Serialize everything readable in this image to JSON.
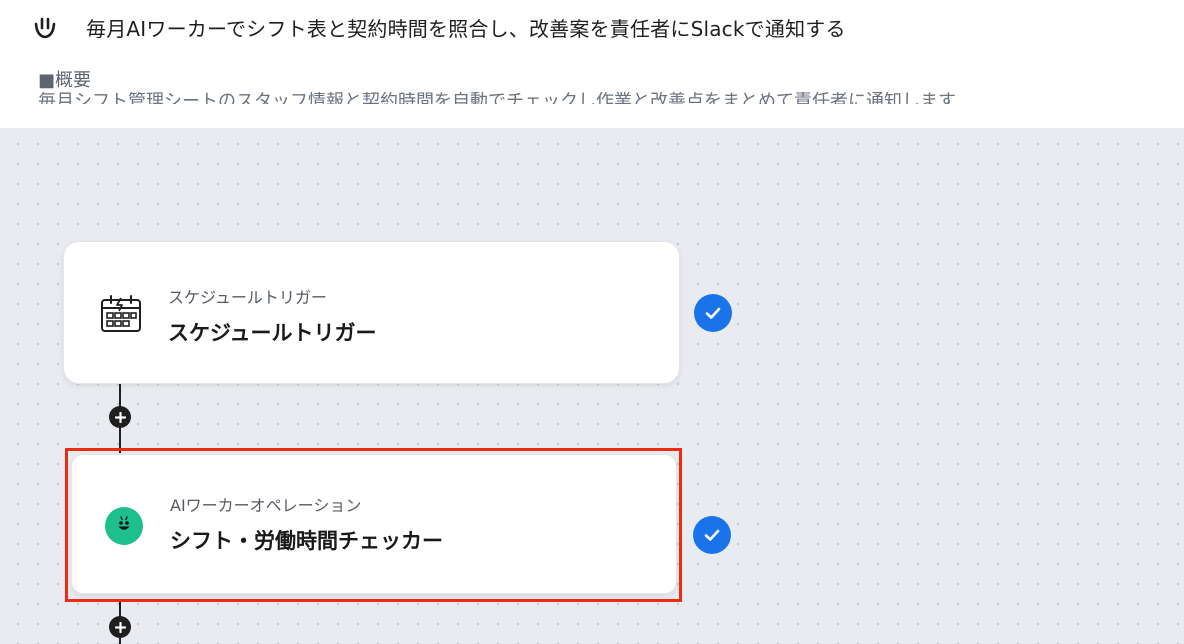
{
  "header": {
    "icon": "smile-icon",
    "title": "毎月AIワーカーでシフト表と契約時間を照合し、改善案を責任者にSlackで通知する",
    "section_label": "■概要",
    "description_clipped": "毎月シフト管理シートのスタッフ情報と契約時間を自動でチェックし作業と改善点をまとめて責任者に通知します"
  },
  "flow": {
    "steps": [
      {
        "type_label": "スケジュールトリガー",
        "name": "スケジュールトリガー",
        "icon": "calendar-clock-icon",
        "status": "completed"
      },
      {
        "type_label": "AIワーカーオペレーション",
        "name": "シフト・労働時間チェッカー",
        "icon": "ai-worker-icon",
        "status": "completed",
        "highlighted": true
      }
    ]
  },
  "colors": {
    "check": "#1a73e8",
    "highlight": "#ee2a10",
    "ai_icon": "#1dc08c"
  }
}
